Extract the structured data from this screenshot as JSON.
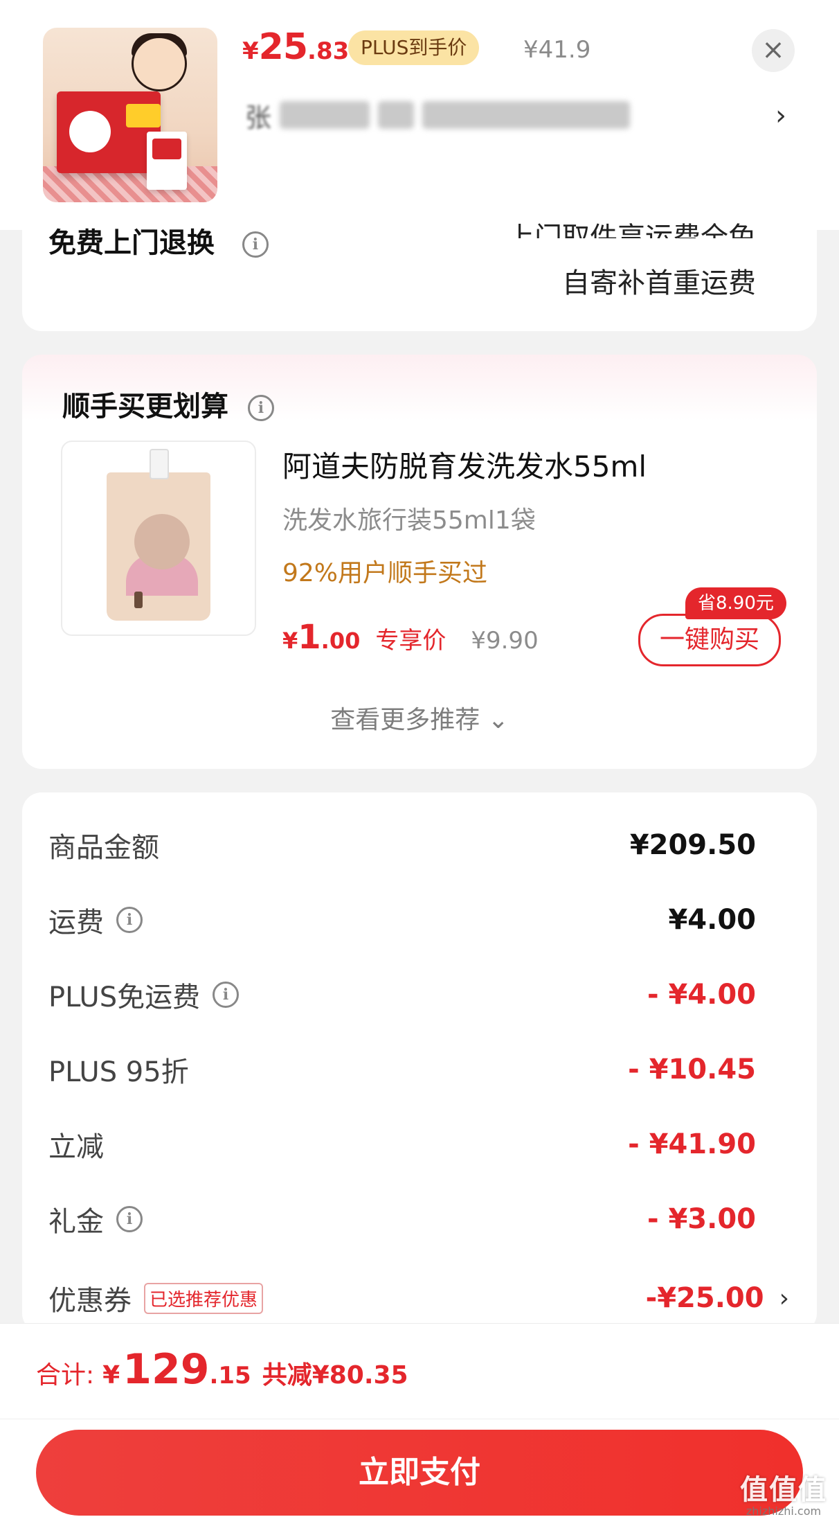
{
  "product": {
    "price_currency": "¥",
    "price_int": "25",
    "price_dec": ".83",
    "plus_badge": "PLUS到手价",
    "original_price": "¥41.9",
    "name_lead": "张",
    "close": "×",
    "chevron": "›"
  },
  "return_service": {
    "title": "免费上门退换",
    "line1": "上门取件享运费全免",
    "line2": "自寄补首重运费",
    "info": "i"
  },
  "recommend": {
    "title": "顺手买更划算",
    "info": "i",
    "item": {
      "name": "阿道夫防脱育发洗发水55ml",
      "spec": "洗发水旅行装55ml1袋",
      "social": "92%用户顺手买过",
      "price_currency": "¥",
      "price_int": "1",
      "price_dec": ".00",
      "price_tag": "专享价",
      "original_price": "¥9.90",
      "save_badge": "省8.90元",
      "buy_label": "一键购买"
    },
    "more_label": "查看更多推荐 ⌄"
  },
  "summary": {
    "rows": [
      {
        "label": "商品金额",
        "value": "¥209.50",
        "info": false,
        "negative": false
      },
      {
        "label": "运费",
        "value": "¥4.00",
        "info": true,
        "negative": false
      },
      {
        "label": "PLUS免运费",
        "value": "- ¥4.00",
        "info": true,
        "negative": true
      },
      {
        "label": "PLUS 95折",
        "value": "- ¥10.45",
        "info": false,
        "negative": true
      },
      {
        "label": "立减",
        "value": "- ¥41.90",
        "info": false,
        "negative": true
      },
      {
        "label": "礼金",
        "value": "- ¥3.00",
        "info": true,
        "negative": true
      }
    ],
    "coupon": {
      "label": "优惠券",
      "tag": "已选推荐优惠",
      "value": "-¥25.00",
      "chevron": "›"
    }
  },
  "footer": {
    "total_label": "合计:",
    "total_currency": "¥",
    "total_int": "129",
    "total_dec": ".15",
    "total_saved": "共减¥80.35",
    "pay_label": "立即支付"
  },
  "watermark": {
    "main": "值值值",
    "sub": "zhizhizhi.com"
  },
  "colors": {
    "accent_red": "#e4262c",
    "plus_gold": "#fbe3a4",
    "social_orange": "#c2781b",
    "page_bg": "#f2f2f2"
  }
}
